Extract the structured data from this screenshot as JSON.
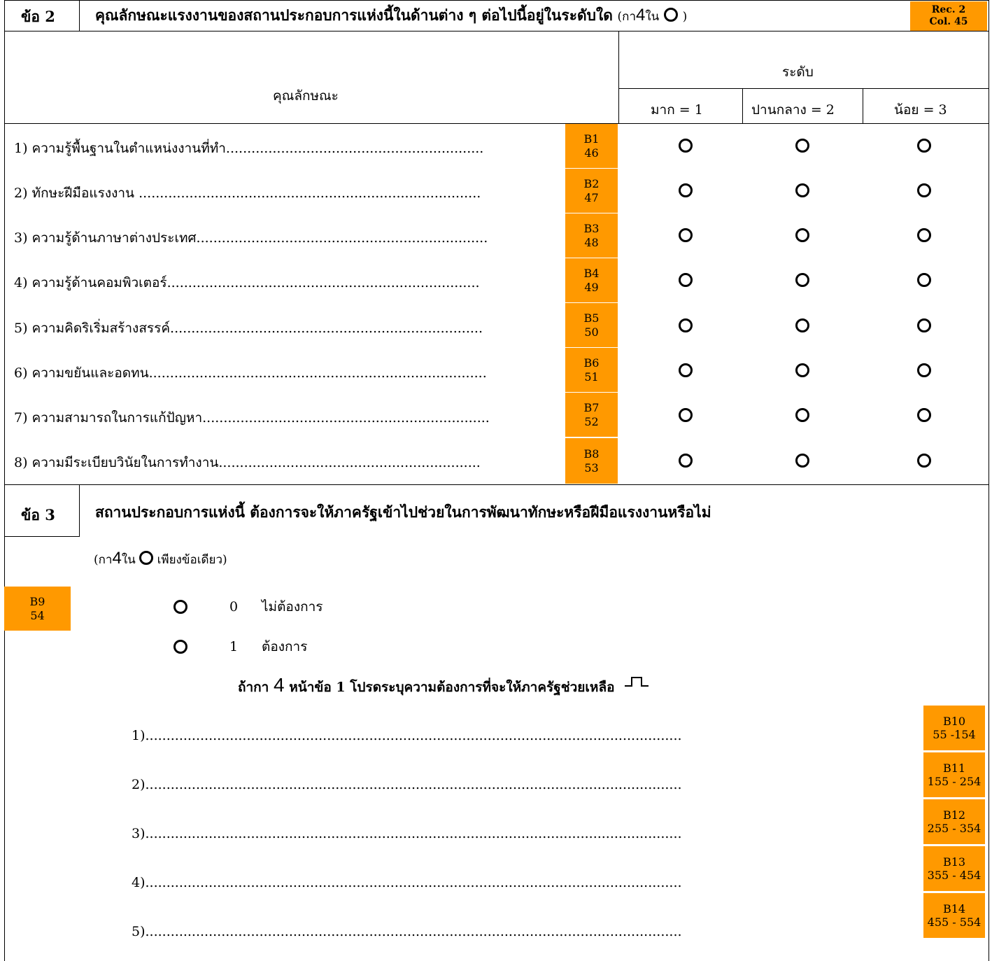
{
  "q2": {
    "number": "ข้อ 2",
    "title": "คุณลักษณะแรงงานของสถานประกอบการแห่งนี้ในด้านต่าง ๆ ต่อไปนี้อยู่ในระดับใด",
    "instruction_prefix": "(กา",
    "instruction_mark": "4",
    "instruction_in": "ใน",
    "instruction_suffix": ")",
    "rec_line1": "Rec. 2",
    "rec_line2": "Col. 45",
    "col_header": "คุณลักษณะ",
    "level_header": "ระดับ",
    "levels": [
      "มาก = 1",
      "ปานกลาง = 2",
      "น้อย = 3"
    ],
    "rows": [
      {
        "text": "1) ความรู้พื้นฐานในตำแหน่งงานที่ทำ.............................................................",
        "code": "B1",
        "col": "46"
      },
      {
        "text": "2) ทักษะฝีมือแรงงาน .................................................................................",
        "code": "B2",
        "col": "47"
      },
      {
        "text": "3) ความรู้ด้านภาษาต่างประเทศ.....................................................................",
        "code": "B3",
        "col": "48"
      },
      {
        "text": "4) ความรู้ด้านคอมพิวเตอร์..........................................................................",
        "code": "B4",
        "col": "49"
      },
      {
        "text": "5) ความคิดริเริ่มสร้างสรรค์..........................................................................",
        "code": "B5",
        "col": "50"
      },
      {
        "text": "6) ความขยันและอดทน................................................................................",
        "code": "B6",
        "col": "51"
      },
      {
        "text": "7) ความสามารถในการแก้ปัญหา....................................................................",
        "code": "B7",
        "col": "52"
      },
      {
        "text": "8) ความมีระเบียบวินัยในการทำงาน..............................................................",
        "code": "B8",
        "col": "53"
      }
    ]
  },
  "q3": {
    "number": "ข้อ 3",
    "title": "สถานประกอบการแห่งนี้ ต้องการจะให้ภาครัฐเข้าไปช่วยในการพัฒนาทักษะหรือฝีมือแรงงานหรือไม่",
    "instruction_prefix": "(กา",
    "instruction_mark": "4",
    "instruction_in": "ใน",
    "instruction_suffix": "เพียงข้อเดียว)",
    "code": "B9",
    "col": "54",
    "options": [
      {
        "value": "0",
        "label": "ไม่ต้องการ"
      },
      {
        "value": "1",
        "label": "ต้องการ"
      }
    ],
    "followup_prefix": "ถ้ากา",
    "followup_mark": "4",
    "followup_text": "หน้าข้อ 1 โปรดระบุความต้องการที่จะให้ภาครัฐช่วยเหลือ",
    "lines": [
      {
        "text": "1)...............................................................................................................................",
        "code": "B10",
        "col": "55 -154"
      },
      {
        "text": "2)...............................................................................................................................",
        "code": "B11",
        "col": "155 - 254"
      },
      {
        "text": "3)...............................................................................................................................",
        "code": "B12",
        "col": "255 - 354"
      },
      {
        "text": "4)...............................................................................................................................",
        "code": "B13",
        "col": "355 - 454"
      },
      {
        "text": "5)...............................................................................................................................",
        "code": "B14",
        "col": "455 - 554"
      }
    ]
  }
}
